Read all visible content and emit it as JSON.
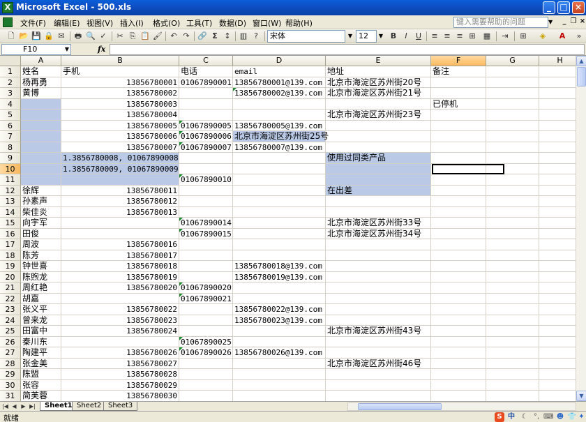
{
  "window": {
    "title": "Microsoft Excel - 500.xls",
    "app_icon": "X"
  },
  "menu": [
    "文件(F)",
    "编辑(E)",
    "视图(V)",
    "插入(I)",
    "格式(O)",
    "工具(T)",
    "数据(D)",
    "窗口(W)",
    "帮助(H)"
  ],
  "help_placeholder": "键入需要帮助的问题",
  "toolbar": {
    "font_name": "宋体",
    "font_size": "12",
    "bold": "B",
    "italic": "I",
    "underline": "U",
    "sum": "Σ",
    "zoom_icon_label": "?"
  },
  "name_box": "F10",
  "fx_label": "fx",
  "columns": [
    "A",
    "B",
    "C",
    "D",
    "E",
    "F",
    "G",
    "H"
  ],
  "rows": [
    {
      "n": "1",
      "a": "姓名",
      "b": "手机",
      "c": "电话",
      "d": "email",
      "e": "地址",
      "f": "备注"
    },
    {
      "n": "2",
      "a": "杨再勇",
      "b": "13856780001",
      "c": "01067890001",
      "d": "13856780001@139.com",
      "e": "北京市海淀区苏州街20号",
      "f": ""
    },
    {
      "n": "3",
      "a": "黄博",
      "b": "13856780002",
      "c": "",
      "d": "13856780002@139.com",
      "e": "北京市海淀区苏州街21号",
      "f": ""
    },
    {
      "n": "4",
      "a": "",
      "b": "13856780003",
      "c": "",
      "d": "",
      "e": "",
      "f": "已停机"
    },
    {
      "n": "5",
      "a": "",
      "b": "13856780004",
      "c": "",
      "d": "",
      "e": "北京市海淀区苏州街23号",
      "f": ""
    },
    {
      "n": "6",
      "a": "",
      "b": "13856780005",
      "c": "01067890005",
      "d": "13856780005@139.com",
      "e": "",
      "f": ""
    },
    {
      "n": "7",
      "a": "",
      "b": "13856780006",
      "c": "01067890006",
      "d": "北京市海淀区苏州街25号",
      "e": "",
      "f": ""
    },
    {
      "n": "8",
      "a": "",
      "b": "13856780007",
      "c": "01067890007",
      "d": "13856780007@139.com",
      "e": "",
      "f": ""
    },
    {
      "n": "9",
      "a": "",
      "b": "1.3856780008, 01067890008",
      "c": "",
      "d": "",
      "e": "使用过同类产品",
      "f": ""
    },
    {
      "n": "10",
      "a": "",
      "b": "1.3856780009, 01067890009",
      "c": "",
      "d": "",
      "e": "",
      "f": ""
    },
    {
      "n": "11",
      "a": "",
      "b": "",
      "c": "01067890010",
      "d": "",
      "e": "",
      "f": ""
    },
    {
      "n": "12",
      "a": "徐辉",
      "b": "13856780011",
      "c": "",
      "d": "",
      "e": "在出差",
      "f": ""
    },
    {
      "n": "13",
      "a": "孙素声",
      "b": "13856780012",
      "c": "",
      "d": "",
      "e": "",
      "f": ""
    },
    {
      "n": "14",
      "a": "柴佳炎",
      "b": "13856780013",
      "c": "",
      "d": "",
      "e": "",
      "f": ""
    },
    {
      "n": "15",
      "a": "向宇军",
      "b": "",
      "c": "01067890014",
      "d": "",
      "e": "北京市海淀区苏州街33号",
      "f": ""
    },
    {
      "n": "16",
      "a": "田俊",
      "b": "",
      "c": "01067890015",
      "d": "",
      "e": "北京市海淀区苏州街34号",
      "f": ""
    },
    {
      "n": "17",
      "a": "周波",
      "b": "13856780016",
      "c": "",
      "d": "",
      "e": "",
      "f": ""
    },
    {
      "n": "18",
      "a": "陈芳",
      "b": "13856780017",
      "c": "",
      "d": "",
      "e": "",
      "f": ""
    },
    {
      "n": "19",
      "a": "钟世喜",
      "b": "13856780018",
      "c": "",
      "d": "13856780018@139.com",
      "e": "",
      "f": ""
    },
    {
      "n": "20",
      "a": "陈煦龙",
      "b": "13856780019",
      "c": "",
      "d": "13856780019@139.com",
      "e": "",
      "f": ""
    },
    {
      "n": "21",
      "a": "周红艳",
      "b": "13856780020",
      "c": "01067890020",
      "d": "",
      "e": "",
      "f": ""
    },
    {
      "n": "22",
      "a": "胡嘉",
      "b": "",
      "c": "01067890021",
      "d": "",
      "e": "",
      "f": ""
    },
    {
      "n": "23",
      "a": "张义平",
      "b": "13856780022",
      "c": "",
      "d": "13856780022@139.com",
      "e": "",
      "f": ""
    },
    {
      "n": "24",
      "a": "曾来龙",
      "b": "13856780023",
      "c": "",
      "d": "13856780023@139.com",
      "e": "",
      "f": ""
    },
    {
      "n": "25",
      "a": "田富中",
      "b": "13856780024",
      "c": "",
      "d": "",
      "e": "北京市海淀区苏州街43号",
      "f": ""
    },
    {
      "n": "26",
      "a": "秦川东",
      "b": "",
      "c": "01067890025",
      "d": "",
      "e": "",
      "f": ""
    },
    {
      "n": "27",
      "a": "陶建平",
      "b": "13856780026",
      "c": "01067890026",
      "d": "13856780026@139.com",
      "e": "",
      "f": ""
    },
    {
      "n": "28",
      "a": "张金美",
      "b": "13856780027",
      "c": "",
      "d": "",
      "e": "北京市海淀区苏州街46号",
      "f": ""
    },
    {
      "n": "29",
      "a": "陈盟",
      "b": "13856780028",
      "c": "",
      "d": "",
      "e": "",
      "f": ""
    },
    {
      "n": "30",
      "a": "张容",
      "b": "13856780029",
      "c": "",
      "d": "",
      "e": "",
      "f": ""
    },
    {
      "n": "31",
      "a": "简芙蓉",
      "b": "13856780030",
      "c": "",
      "d": "",
      "e": "",
      "f": ""
    }
  ],
  "sheets": [
    "Sheet1",
    "Sheet2",
    "Sheet3"
  ],
  "status": "就绪",
  "ime": {
    "s_label": "S",
    "lang": "中"
  },
  "colors": {
    "selection": "#b9c9e6",
    "header_selected": "#f9b95f",
    "title_bar": "#0a5fd8"
  }
}
